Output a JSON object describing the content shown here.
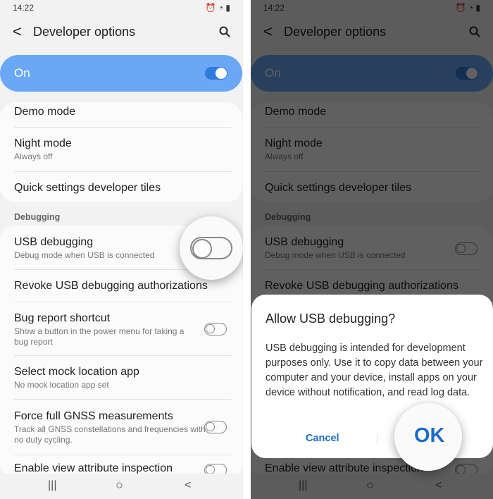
{
  "status": {
    "time": "14:22"
  },
  "header": {
    "title": "Developer options",
    "back": "<",
    "search_icon": "search-icon"
  },
  "master": {
    "label": "On",
    "state": true
  },
  "card1": [
    {
      "title": "Demo mode"
    },
    {
      "title": "Night mode",
      "sub": "Always off"
    },
    {
      "title": "Quick settings developer tiles"
    }
  ],
  "section": "Debugging",
  "card2": [
    {
      "title": "USB debugging",
      "sub": "Debug mode when USB is connected",
      "toggle": false
    },
    {
      "title": "Revoke USB debugging authorizations"
    },
    {
      "title": "Bug report shortcut",
      "sub": "Show a button in the power menu for taking a bug report",
      "toggle": false
    },
    {
      "title": "Select mock location app",
      "sub": "No mock location app set"
    },
    {
      "title": "Force full GNSS measurements",
      "sub": "Track all GNSS constellations and frequencies with no duty cycling.",
      "toggle": false
    },
    {
      "title": "Enable view attribute inspection",
      "toggle": false
    }
  ],
  "nav": {
    "recents": "|||",
    "home": "○",
    "back": "<"
  },
  "dialog": {
    "title": "Allow USB debugging?",
    "body": "USB debugging is intended for development purposes only. Use it to copy data between your computer and your device, install apps on your device without notification, and read log data.",
    "cancel": "Cancel",
    "ok": "OK"
  },
  "colors": {
    "accent": "#6aa8f5",
    "toggle_on": "#2f7be0",
    "dialog_button": "#1b6cc6"
  }
}
